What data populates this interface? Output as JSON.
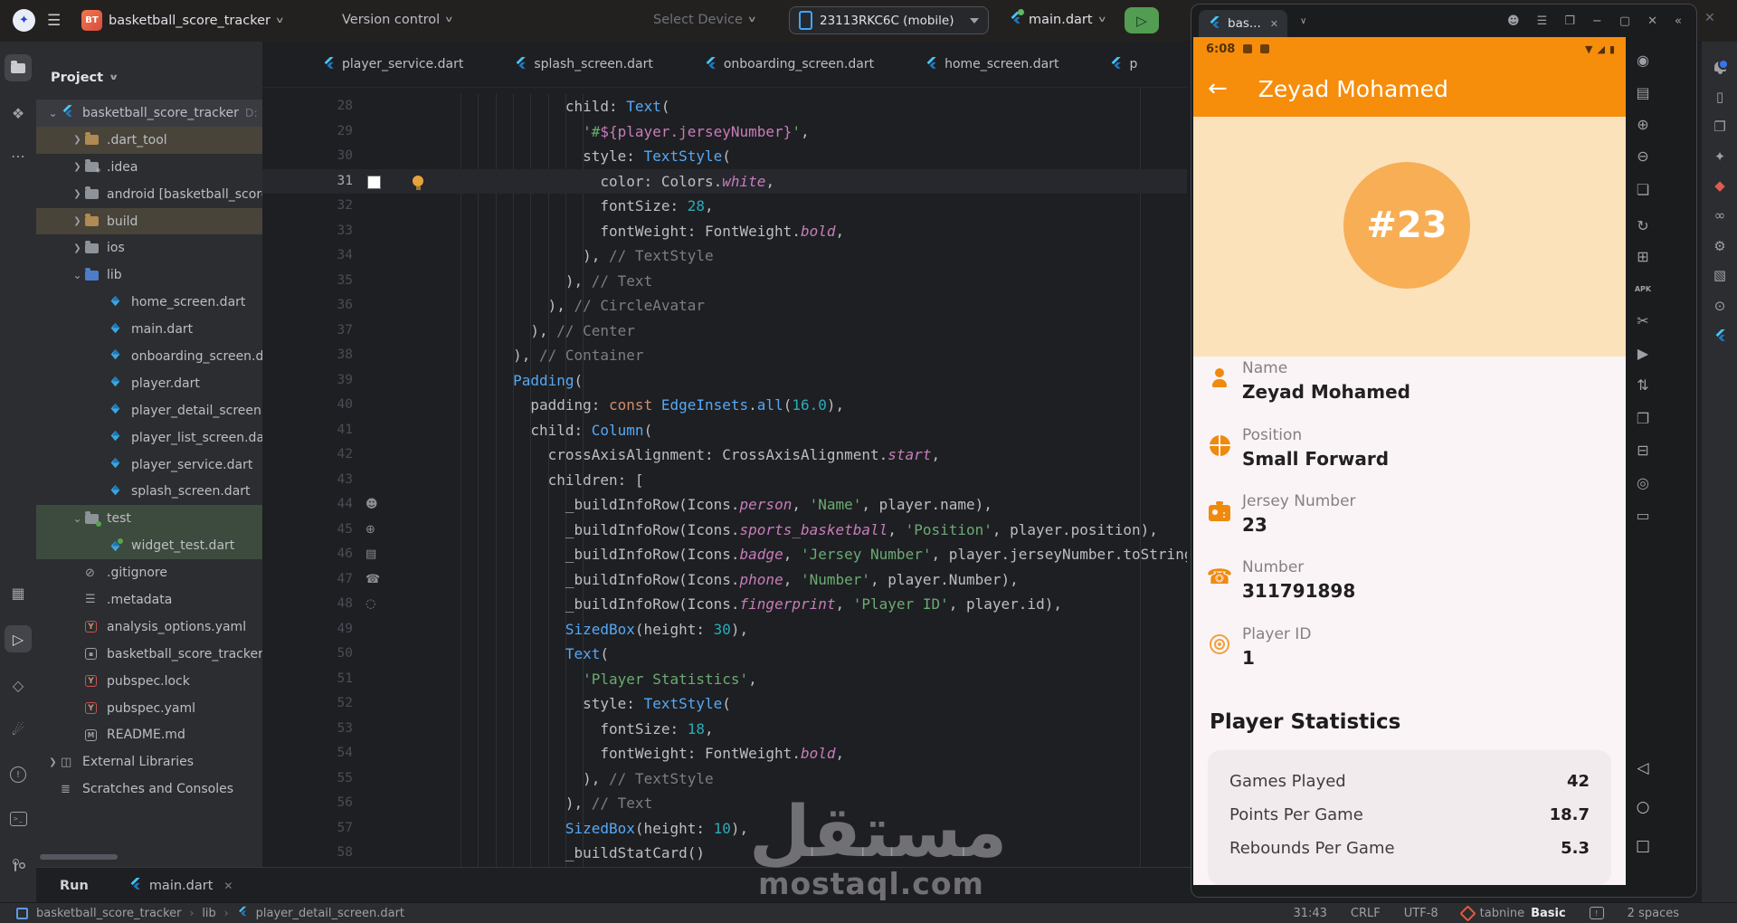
{
  "title_bar": {
    "project": "basketball_score_tracker",
    "version_control": "Version control",
    "select_device": "Select Device",
    "device": "23113RKC6C (mobile)",
    "run_config": "main.dart",
    "logo_glyph": "✦",
    "project_badge": "BT"
  },
  "activity_bar": {
    "top": [
      {
        "name": "project-icon",
        "kind": "folder",
        "selected": true
      },
      {
        "name": "structure-icon",
        "glyph": "❖"
      },
      {
        "name": "more-tool-windows-icon",
        "glyph": "⋯"
      }
    ],
    "bottom": [
      {
        "name": "build-variants-icon",
        "glyph": "▦"
      },
      {
        "name": "run-icon",
        "glyph": "▷",
        "selected": true
      },
      {
        "name": "dart-analysis-icon",
        "glyph": "◇"
      },
      {
        "name": "devtools-icon",
        "glyph": "☄"
      },
      {
        "name": "problems-icon",
        "kind": "circle-bang"
      },
      {
        "name": "terminal-icon",
        "kind": "terminal"
      },
      {
        "name": "git-icon",
        "kind": "git"
      }
    ]
  },
  "project_panel": {
    "title": "Project",
    "tree": [
      {
        "depth": 0,
        "chevron": "open",
        "icon": "flutter",
        "label": "basketball_score_tracker",
        "extra": "D:",
        "bg": "sel"
      },
      {
        "depth": 1,
        "chevron": "closed",
        "icon": "folder-ex",
        "label": ".dart_tool",
        "bg": "warm"
      },
      {
        "depth": 1,
        "chevron": "closed",
        "icon": "folder-idea",
        "label": ".idea"
      },
      {
        "depth": 1,
        "chevron": "closed",
        "icon": "folder",
        "label": "android [basketball_score"
      },
      {
        "depth": 1,
        "chevron": "closed",
        "icon": "folder-ex",
        "label": "build",
        "bg": "warm"
      },
      {
        "depth": 1,
        "chevron": "closed",
        "icon": "folder",
        "label": "ios"
      },
      {
        "depth": 1,
        "chevron": "open",
        "icon": "folder-blue",
        "label": "lib"
      },
      {
        "depth": 2,
        "icon": "dart",
        "label": "home_screen.dart"
      },
      {
        "depth": 2,
        "icon": "dart",
        "label": "main.dart"
      },
      {
        "depth": 2,
        "icon": "dart",
        "label": "onboarding_screen.dart"
      },
      {
        "depth": 2,
        "icon": "dart",
        "label": "player.dart"
      },
      {
        "depth": 2,
        "icon": "dart",
        "label": "player_detail_screen.dart"
      },
      {
        "depth": 2,
        "icon": "dart",
        "label": "player_list_screen.dart"
      },
      {
        "depth": 2,
        "icon": "dart",
        "label": "player_service.dart"
      },
      {
        "depth": 2,
        "icon": "dart",
        "label": "splash_screen.dart"
      },
      {
        "depth": 1,
        "chevron": "open",
        "icon": "folder-test",
        "label": "test",
        "bg": "green"
      },
      {
        "depth": 2,
        "icon": "dart-test",
        "label": "widget_test.dart",
        "bg": "green"
      },
      {
        "depth": 1,
        "icon": "ignore",
        "label": ".gitignore"
      },
      {
        "depth": 1,
        "icon": "lines",
        "label": ".metadata"
      },
      {
        "depth": 1,
        "icon": "yaml",
        "label": "analysis_options.yaml"
      },
      {
        "depth": 1,
        "icon": "iml",
        "label": "basketball_score_tracker.iml"
      },
      {
        "depth": 1,
        "icon": "yaml",
        "label": "pubspec.lock"
      },
      {
        "depth": 1,
        "icon": "yaml",
        "label": "pubspec.yaml"
      },
      {
        "depth": 1,
        "icon": "md",
        "label": "README.md"
      },
      {
        "depth": 0,
        "chevron": "closed",
        "icon": "extlib",
        "label": "External Libraries"
      },
      {
        "depth": 0,
        "icon": "scratch",
        "label": "Scratches and Consoles"
      }
    ]
  },
  "editor": {
    "tabs": [
      {
        "label": "player_service.dart"
      },
      {
        "label": "splash_screen.dart"
      },
      {
        "label": "onboarding_screen.dart"
      },
      {
        "label": "home_screen.dart"
      },
      {
        "label": "p"
      }
    ],
    "gutter_glyphs": {
      "person": "☻",
      "basketball": "⊕",
      "badge": "▤",
      "phone": "☎",
      "fingerprint": "◌"
    },
    "lines": [
      {
        "n": 28,
        "ind": 14,
        "seg": [
          [
            "child: ",
            "def"
          ],
          [
            "Text",
            "cls"
          ],
          [
            "(",
            "def"
          ]
        ]
      },
      {
        "n": 29,
        "ind": 16,
        "seg": [
          [
            "'#",
            "str"
          ],
          [
            "${player.jerseyNumber}",
            "ipl"
          ],
          [
            "'",
            "str"
          ],
          [
            ",",
            "def"
          ]
        ]
      },
      {
        "n": 30,
        "ind": 16,
        "seg": [
          [
            "style: ",
            "def"
          ],
          [
            "TextStyle",
            "cls"
          ],
          [
            "(",
            "def"
          ]
        ]
      },
      {
        "n": 31,
        "ind": 18,
        "cur": true,
        "swatch": true,
        "bulb": true,
        "seg": [
          [
            "color: ",
            "def"
          ],
          [
            "Colors",
            "def"
          ],
          [
            ".",
            "def"
          ],
          [
            "white",
            "prop"
          ],
          [
            ",",
            "def"
          ]
        ]
      },
      {
        "n": 32,
        "ind": 18,
        "seg": [
          [
            "fontSize: ",
            "def"
          ],
          [
            "28",
            "num"
          ],
          [
            ",",
            "def"
          ]
        ]
      },
      {
        "n": 33,
        "ind": 18,
        "seg": [
          [
            "fontWeight: ",
            "def"
          ],
          [
            "FontWeight",
            "def"
          ],
          [
            ".",
            "def"
          ],
          [
            "bold",
            "prop"
          ],
          [
            ",",
            "def"
          ]
        ]
      },
      {
        "n": 34,
        "ind": 16,
        "seg": [
          [
            "), ",
            "def"
          ],
          [
            "// TextStyle",
            "com"
          ]
        ]
      },
      {
        "n": 35,
        "ind": 14,
        "seg": [
          [
            "), ",
            "def"
          ],
          [
            "// Text",
            "com"
          ]
        ]
      },
      {
        "n": 36,
        "ind": 12,
        "seg": [
          [
            "), ",
            "def"
          ],
          [
            "// CircleAvatar",
            "com"
          ]
        ]
      },
      {
        "n": 37,
        "ind": 10,
        "seg": [
          [
            "), ",
            "def"
          ],
          [
            "// Center",
            "com"
          ]
        ]
      },
      {
        "n": 38,
        "ind": 8,
        "seg": [
          [
            "), ",
            "def"
          ],
          [
            "// Container",
            "com"
          ]
        ]
      },
      {
        "n": 39,
        "ind": 8,
        "seg": [
          [
            "Padding",
            "cls"
          ],
          [
            "(",
            "def"
          ]
        ]
      },
      {
        "n": 40,
        "ind": 10,
        "seg": [
          [
            "padding: ",
            "def"
          ],
          [
            "const ",
            "kw"
          ],
          [
            "EdgeInsets",
            "cls"
          ],
          [
            ".",
            "def"
          ],
          [
            "all",
            "cls"
          ],
          [
            "(",
            "def"
          ],
          [
            "16.0",
            "num"
          ],
          [
            "),",
            "def"
          ]
        ]
      },
      {
        "n": 41,
        "ind": 10,
        "seg": [
          [
            "child: ",
            "def"
          ],
          [
            "Column",
            "cls"
          ],
          [
            "(",
            "def"
          ]
        ]
      },
      {
        "n": 42,
        "ind": 12,
        "seg": [
          [
            "crossAxisAlignment: ",
            "def"
          ],
          [
            "CrossAxisAlignment",
            "def"
          ],
          [
            ".",
            "def"
          ],
          [
            "start",
            "prop"
          ],
          [
            ",",
            "def"
          ]
        ]
      },
      {
        "n": 43,
        "ind": 12,
        "seg": [
          [
            "children: [",
            "def"
          ]
        ]
      },
      {
        "n": 44,
        "ind": 14,
        "gut": "person",
        "seg": [
          [
            "_buildInfoRow(Icons",
            "def"
          ],
          [
            ".",
            "def"
          ],
          [
            "person",
            "prop"
          ],
          [
            ", ",
            "def"
          ],
          [
            "'Name'",
            "str"
          ],
          [
            ", player.name),",
            "def"
          ]
        ]
      },
      {
        "n": 45,
        "ind": 14,
        "gut": "basketball",
        "seg": [
          [
            "_buildInfoRow(Icons",
            "def"
          ],
          [
            ".",
            "def"
          ],
          [
            "sports_basketball",
            "prop"
          ],
          [
            ", ",
            "def"
          ],
          [
            "'Position'",
            "str"
          ],
          [
            ", player.position),",
            "def"
          ]
        ]
      },
      {
        "n": 46,
        "ind": 14,
        "gut": "badge",
        "seg": [
          [
            "_buildInfoRow(Icons",
            "def"
          ],
          [
            ".",
            "def"
          ],
          [
            "badge",
            "prop"
          ],
          [
            ", ",
            "def"
          ],
          [
            "'Jersey Number'",
            "str"
          ],
          [
            ", player.jerseyNumber.toString()),",
            "def"
          ]
        ]
      },
      {
        "n": 47,
        "ind": 14,
        "gut": "phone",
        "seg": [
          [
            "_buildInfoRow(Icons",
            "def"
          ],
          [
            ".",
            "def"
          ],
          [
            "phone",
            "prop"
          ],
          [
            ", ",
            "def"
          ],
          [
            "'Number'",
            "str"
          ],
          [
            ", player.Number),",
            "def"
          ]
        ]
      },
      {
        "n": 48,
        "ind": 14,
        "gut": "fingerprint",
        "seg": [
          [
            "_buildInfoRow(Icons",
            "def"
          ],
          [
            ".",
            "def"
          ],
          [
            "fingerprint",
            "prop"
          ],
          [
            ", ",
            "def"
          ],
          [
            "'Player ID'",
            "str"
          ],
          [
            ", player.id),",
            "def"
          ]
        ]
      },
      {
        "n": 49,
        "ind": 14,
        "seg": [
          [
            "SizedBox",
            "cls"
          ],
          [
            "(height: ",
            "def"
          ],
          [
            "30",
            "num"
          ],
          [
            "),",
            "def"
          ]
        ]
      },
      {
        "n": 50,
        "ind": 14,
        "seg": [
          [
            "Text",
            "cls"
          ],
          [
            "(",
            "def"
          ]
        ]
      },
      {
        "n": 51,
        "ind": 16,
        "seg": [
          [
            "'Player Statistics'",
            "str"
          ],
          [
            ",",
            "def"
          ]
        ]
      },
      {
        "n": 52,
        "ind": 16,
        "seg": [
          [
            "style: ",
            "def"
          ],
          [
            "TextStyle",
            "cls"
          ],
          [
            "(",
            "def"
          ]
        ]
      },
      {
        "n": 53,
        "ind": 18,
        "seg": [
          [
            "fontSize: ",
            "def"
          ],
          [
            "18",
            "num"
          ],
          [
            ",",
            "def"
          ]
        ]
      },
      {
        "n": 54,
        "ind": 18,
        "seg": [
          [
            "fontWeight: ",
            "def"
          ],
          [
            "FontWeight",
            "def"
          ],
          [
            ".",
            "def"
          ],
          [
            "bold",
            "prop"
          ],
          [
            ",",
            "def"
          ]
        ]
      },
      {
        "n": 55,
        "ind": 16,
        "seg": [
          [
            "), ",
            "def"
          ],
          [
            "// TextStyle",
            "com"
          ]
        ]
      },
      {
        "n": 56,
        "ind": 14,
        "seg": [
          [
            "), ",
            "def"
          ],
          [
            "// Text",
            "com"
          ]
        ]
      },
      {
        "n": 57,
        "ind": 14,
        "seg": [
          [
            "SizedBox",
            "cls"
          ],
          [
            "(height: ",
            "def"
          ],
          [
            "10",
            "num"
          ],
          [
            "),",
            "def"
          ]
        ]
      },
      {
        "n": 58,
        "ind": 14,
        "seg": [
          [
            "_buildStatCard()",
            "def"
          ]
        ]
      }
    ]
  },
  "run_bar": {
    "label": "Run",
    "tab": "main.dart"
  },
  "status_bar": {
    "breadcrumbs": [
      "basketball_score_tracker",
      "lib",
      "player_detail_screen.dart"
    ],
    "position": "31:43",
    "line_sep": "CRLF",
    "encoding": "UTF-8",
    "tabnine": "tabnine",
    "tabnine_plan": "Basic",
    "indent": "2 spaces"
  },
  "device_panel": {
    "tab_label": "bas...",
    "window_icons": [
      {
        "name": "account-icon",
        "glyph": "☻"
      },
      {
        "name": "panel-menu-icon",
        "glyph": "☰"
      },
      {
        "name": "float-window-icon",
        "glyph": "❐"
      },
      {
        "name": "minimize-icon",
        "glyph": "−"
      },
      {
        "name": "maximize-icon",
        "glyph": "▢"
      },
      {
        "name": "close-icon",
        "glyph": "✕"
      },
      {
        "name": "collapse-icon",
        "glyph": "«"
      }
    ],
    "toolbar": [
      {
        "name": "power-icon",
        "glyph": "◉"
      },
      {
        "name": "snapshot-icon",
        "glyph": "▤"
      },
      {
        "name": "volume-up-icon",
        "glyph": "⊕"
      },
      {
        "name": "volume-down-icon",
        "glyph": "⊖"
      },
      {
        "name": "screenshot-icon",
        "glyph": "❏"
      },
      {
        "name": "rotate-icon",
        "glyph": "↻"
      },
      {
        "name": "add-box-icon",
        "glyph": "⊞"
      },
      {
        "name": "install-apk-icon",
        "glyph": "APK",
        "small": true
      },
      {
        "name": "snip-icon",
        "glyph": "✂"
      },
      {
        "name": "screen-record-icon",
        "glyph": "▶"
      },
      {
        "name": "resize-icon",
        "glyph": "⇅"
      },
      {
        "name": "mirror-display-icon",
        "glyph": "❐"
      },
      {
        "name": "sync-folder-icon",
        "glyph": "⊟"
      },
      {
        "name": "location-icon",
        "glyph": "◎"
      },
      {
        "name": "wallet-icon",
        "glyph": "▭"
      }
    ],
    "nav_buttons": [
      {
        "name": "back-button",
        "glyph": "◁"
      },
      {
        "name": "home-button",
        "glyph": "○"
      },
      {
        "name": "recents-button",
        "glyph": "□"
      }
    ],
    "phone": {
      "time": "6:08",
      "title": "Zeyad Mohamed",
      "avatar_number": "#23",
      "info_rows": [
        {
          "icon": "person",
          "label": "Name",
          "value": "Zeyad Mohamed"
        },
        {
          "icon": "basketball",
          "label": "Position",
          "value": "Small Forward"
        },
        {
          "icon": "badge",
          "label": "Jersey Number",
          "value": "23"
        },
        {
          "icon": "phone",
          "label": "Number",
          "value": "311791898"
        },
        {
          "icon": "fingerprint",
          "label": "Player ID",
          "value": "1"
        }
      ],
      "stats_title": "Player Statistics",
      "stats": [
        {
          "label": "Games Played",
          "value": "42"
        },
        {
          "label": "Points Per Game",
          "value": "18.7"
        },
        {
          "label": "Rebounds Per Game",
          "value": "5.3"
        }
      ],
      "colors": {
        "appbar": "#F68D0B",
        "peach": "#FBE2BB",
        "avatar": "#F7AE55",
        "background": "#FAF4F6",
        "icon_orange": "#F08A0C"
      }
    }
  },
  "right_bar": [
    {
      "name": "notifications-icon",
      "kind": "bell",
      "badge": true
    },
    {
      "name": "running-devices-icon",
      "glyph": "▯"
    },
    {
      "name": "device-manager-icon",
      "glyph": "❐"
    },
    {
      "name": "gemini-icon",
      "glyph": "✦"
    },
    {
      "name": "app-quality-insights-icon",
      "glyph": "◆",
      "color": "#E05A50"
    },
    {
      "name": "endpoints-icon",
      "glyph": "∞"
    },
    {
      "name": "build-tools-icon",
      "glyph": "⚙"
    },
    {
      "name": "plugins-icon",
      "glyph": "▧"
    },
    {
      "name": "search-icon",
      "glyph": "⊙"
    },
    {
      "name": "flutter-inspector-icon",
      "kind": "flutter"
    }
  ],
  "watermark": {
    "arabic": "مستقل",
    "domain": "mostaql.com"
  }
}
